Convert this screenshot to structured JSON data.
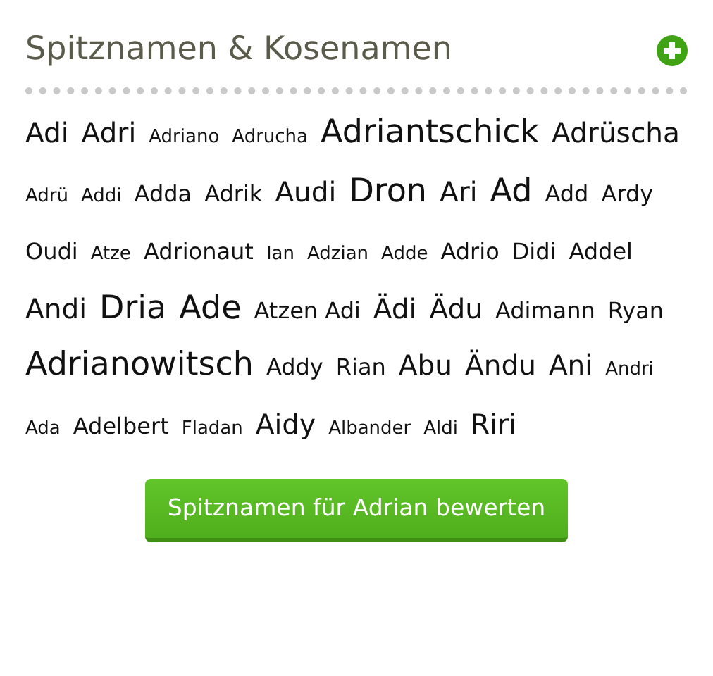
{
  "title": "Spitznamen & Kosenamen",
  "nicknames": [
    {
      "text": "Adi",
      "kind": "large"
    },
    {
      "text": "Adri",
      "kind": "large"
    },
    {
      "text": "Adriano",
      "kind": "small"
    },
    {
      "text": "Adrucha",
      "kind": "small"
    },
    {
      "text": "Adriantschick",
      "kind": "huge"
    },
    {
      "text": "Adrüscha",
      "kind": "large"
    },
    {
      "text": "Adrü",
      "kind": "small"
    },
    {
      "text": "Addi",
      "kind": "small"
    },
    {
      "text": "Adda",
      "kind": "medium"
    },
    {
      "text": "Adrik",
      "kind": "medium"
    },
    {
      "text": "Audi",
      "kind": "large"
    },
    {
      "text": "Dron",
      "kind": "huge"
    },
    {
      "text": "Ari",
      "kind": "large"
    },
    {
      "text": "Ad",
      "kind": "huge"
    },
    {
      "text": "Add",
      "kind": "medium"
    },
    {
      "text": "Ardy",
      "kind": "medium"
    },
    {
      "text": "Oudi",
      "kind": "medium"
    },
    {
      "text": "Atze",
      "kind": "small"
    },
    {
      "text": "Adrionaut",
      "kind": "medium"
    },
    {
      "text": "Ian",
      "kind": "small"
    },
    {
      "text": "Adzian",
      "kind": "small"
    },
    {
      "text": "Adde",
      "kind": "small"
    },
    {
      "text": "Adrio",
      "kind": "medium"
    },
    {
      "text": "Didi",
      "kind": "medium"
    },
    {
      "text": "Addel",
      "kind": "medium"
    },
    {
      "text": "Andi",
      "kind": "large"
    },
    {
      "text": "Dria",
      "kind": "huge"
    },
    {
      "text": "Ade",
      "kind": "huge"
    },
    {
      "text": "Atzen Adi",
      "kind": "medium"
    },
    {
      "text": "Ädi",
      "kind": "large"
    },
    {
      "text": "Ädu",
      "kind": "large"
    },
    {
      "text": "Adimann",
      "kind": "medium"
    },
    {
      "text": "Ryan",
      "kind": "medium"
    },
    {
      "text": "Adrianowitsch",
      "kind": "huge"
    },
    {
      "text": "Addy",
      "kind": "medium"
    },
    {
      "text": "Rian",
      "kind": "medium"
    },
    {
      "text": "Abu",
      "kind": "large"
    },
    {
      "text": "Ändu",
      "kind": "large"
    },
    {
      "text": "Ani",
      "kind": "large"
    },
    {
      "text": "Andri",
      "kind": "small"
    },
    {
      "text": "Ada",
      "kind": "small"
    },
    {
      "text": "Adelbert",
      "kind": "medium"
    },
    {
      "text": "Fladan",
      "kind": "small"
    },
    {
      "text": "Aidy",
      "kind": "large"
    },
    {
      "text": "Albander",
      "kind": "small"
    },
    {
      "text": "Aldi",
      "kind": "small"
    },
    {
      "text": "Riri",
      "kind": "large"
    }
  ],
  "button": "Spitznamen für Adrian bewerten"
}
